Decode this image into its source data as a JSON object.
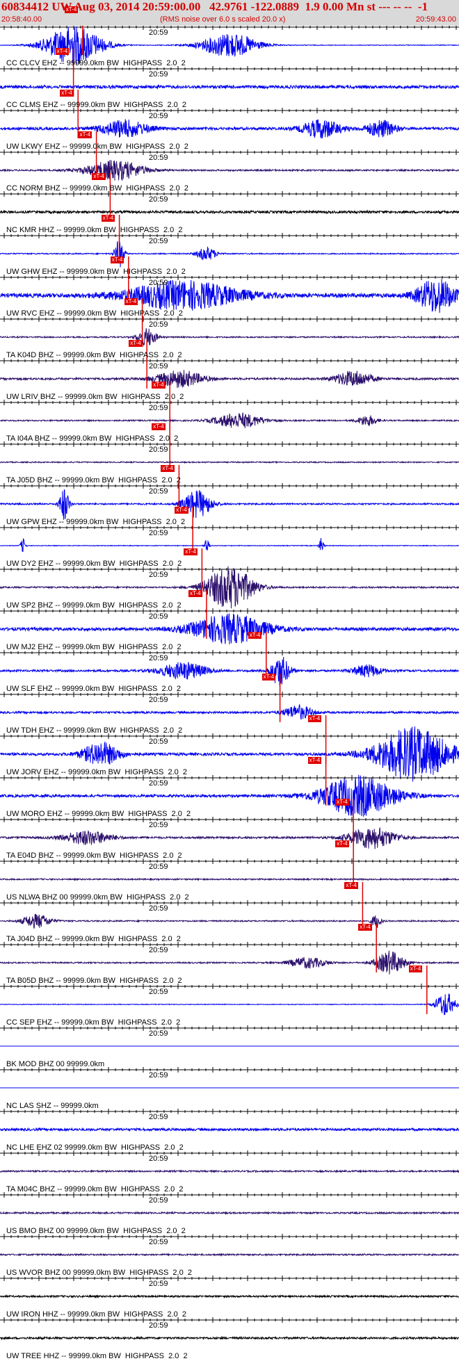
{
  "header": {
    "title": "60834412 UW Aug 03, 2014 20:59:00.00   42.9761 -122.0889  1.9 0.00 Mn st --- -- --  -1",
    "start_time": "20:58:40.00",
    "rms_note": "(RMS noise over 6.0 s scaled 20.0 x)",
    "end_time": "20:59:43.00"
  },
  "colors": {
    "header_bg": "#d9d9d9",
    "header_text": "#d40000",
    "trace_blue": "#0000ee",
    "trace_navy": "#2b0f6b",
    "trace_black": "#000000",
    "pick_red": "#e00000",
    "axis": "#000000"
  },
  "pick_label": "xT-4",
  "minute_label": "20:59",
  "traces": [
    {
      "label": "CC CLCV EHZ -- 99999.0km BW  HIGHPASS  2.0  2",
      "color": "blue",
      "pick": 0.18,
      "bursts": [
        [
          0.16,
          0.06,
          2.6
        ],
        [
          0.5,
          0.06,
          1.6
        ]
      ],
      "noise": 0.15
    },
    {
      "label": "CC CLMS EHZ -- 99999.0km BW  HIGHPASS  2.0  2",
      "color": "blue",
      "pick": 0.16,
      "bursts": [],
      "noise": 0.7
    },
    {
      "label": "UW LKWY EHZ -- 99999.0km BW  HIGHPASS  2.0  2",
      "color": "blue",
      "pick": 0.17,
      "bursts": [
        [
          0.27,
          0.05,
          1.1
        ],
        [
          0.7,
          0.04,
          1.2
        ],
        [
          0.83,
          0.03,
          1.1
        ]
      ],
      "noise": 0.6
    },
    {
      "label": "CC NORM BHZ -- 99999.0km BW  HIGHPASS  2.0  2",
      "color": "navy",
      "pick": 0.21,
      "bursts": [
        [
          0.25,
          0.06,
          1.3
        ]
      ],
      "noise": 0.35
    },
    {
      "label": "NC KMR HHZ -- 99999.0km BW  HIGHPASS  2.0  2",
      "color": "black",
      "pick": 0.24,
      "bursts": [],
      "noise": 0.55
    },
    {
      "label": "UW GHW EHZ -- 99999.0km BW  HIGHPASS  2.0  2",
      "color": "blue",
      "pick": 0.26,
      "bursts": [
        [
          0.26,
          0.01,
          1.8
        ],
        [
          0.45,
          0.02,
          0.9
        ]
      ],
      "noise": 0.25
    },
    {
      "label": "UW RVC EHZ -- 99999.0km BW  HIGHPASS  2.0  2",
      "color": "blue",
      "pick": 0.28,
      "bursts": [
        [
          0.4,
          0.12,
          1.8
        ],
        [
          0.95,
          0.04,
          2.2
        ]
      ],
      "noise": 0.9
    },
    {
      "label": "TA K04D BHZ -- 99999.0km BW  HIGHPASS  2.0  2",
      "color": "navy",
      "pick": 0.31,
      "bursts": [
        [
          0.32,
          0.02,
          1.2
        ]
      ],
      "noise": 0.3
    },
    {
      "label": "UW LRIV BHZ -- 99999.0km BW  HIGHPASS  2.0  2",
      "color": "navy",
      "pick": 0.32,
      "bursts": [
        [
          0.39,
          0.05,
          1.1
        ],
        [
          0.77,
          0.04,
          1.0
        ]
      ],
      "noise": 0.45
    },
    {
      "label": "TA I04A BHZ -- 99999.0km BW  HIGHPASS  2.0  2",
      "color": "navy",
      "pick": 0.37,
      "bursts": [
        [
          0.52,
          0.05,
          1.0
        ],
        [
          0.8,
          0.02,
          0.7
        ]
      ],
      "noise": 0.3
    },
    {
      "label": "TA J05D BHZ -- 99999.0km BW  HIGHPASS  2.0  2",
      "color": "navy",
      "pick": 0.37,
      "bursts": [],
      "noise": 0.25
    },
    {
      "label": "UW GPW EHZ -- 99999.0km BW  HIGHPASS  2.0  2",
      "color": "blue",
      "pick": 0.39,
      "bursts": [
        [
          0.14,
          0.01,
          2.2
        ],
        [
          0.43,
          0.03,
          1.8
        ]
      ],
      "noise": 0.35
    },
    {
      "label": "UW DY2 EHZ -- 99999.0km BW  HIGHPASS  2.0  2",
      "color": "blue",
      "pick": 0.42,
      "bursts": [
        [
          0.05,
          0.005,
          1.0
        ],
        [
          0.45,
          0.005,
          1.0
        ],
        [
          0.7,
          0.005,
          1.0
        ]
      ],
      "noise": 0.15
    },
    {
      "label": "UW SP2 BHZ -- 99999.0km BW  HIGHPASS  2.0  2",
      "color": "navy",
      "pick": 0.44,
      "bursts": [
        [
          0.5,
          0.05,
          2.8
        ]
      ],
      "noise": 0.35
    },
    {
      "label": "UW MJ2 EHZ -- 99999.0km BW  HIGHPASS  2.0  2",
      "color": "blue",
      "pick": 0.45,
      "bursts": [
        [
          0.5,
          0.08,
          1.9
        ]
      ],
      "noise": 0.7
    },
    {
      "label": "UW SLF EHZ -- 99999.0km BW  HIGHPASS  2.0  2",
      "color": "blue",
      "pick": 0.58,
      "bursts": [
        [
          0.4,
          0.05,
          1.1
        ],
        [
          0.61,
          0.02,
          2.0
        ],
        [
          0.8,
          0.03,
          0.8
        ]
      ],
      "noise": 0.45
    },
    {
      "label": "UW TDH EHZ -- 99999.0km BW  HIGHPASS  2.0  2",
      "color": "blue",
      "pick": 0.61,
      "bursts": [
        [
          0.65,
          0.03,
          0.9
        ]
      ],
      "noise": 0.45
    },
    {
      "label": "UW JORV EHZ -- 99999.0km BW  HIGHPASS  2.0  2",
      "color": "blue",
      "pick": 0.71,
      "bursts": [
        [
          0.22,
          0.04,
          1.5
        ],
        [
          0.9,
          0.08,
          3.5
        ]
      ],
      "noise": 0.6
    },
    {
      "label": "UW MORO EHZ -- 99999.0km BW  HIGHPASS  2.0  2",
      "color": "blue",
      "pick": 0.71,
      "bursts": [
        [
          0.78,
          0.08,
          2.6
        ]
      ],
      "noise": 0.6
    },
    {
      "label": "TA E04D BHZ -- 99999.0km BW  HIGHPASS  2.0  2",
      "color": "navy",
      "pick": 0.77,
      "bursts": [
        [
          0.19,
          0.05,
          0.9
        ],
        [
          0.81,
          0.05,
          1.4
        ]
      ],
      "noise": 0.45
    },
    {
      "label": "US NLWA BHZ 00 99999.0km BW  HIGHPASS  2.0  2",
      "color": "navy",
      "pick": 0.77,
      "bursts": [],
      "noise": 0.3
    },
    {
      "label": "TA J04D BHZ -- 99999.0km BW  HIGHPASS  2.0  2",
      "color": "navy",
      "pick": 0.79,
      "bursts": [
        [
          0.08,
          0.03,
          0.9
        ],
        [
          0.82,
          0.01,
          0.9
        ]
      ],
      "noise": 0.3
    },
    {
      "label": "TA B05D BHZ -- 99999.0km BW  HIGHPASS  2.0  2",
      "color": "navy",
      "pick": 0.82,
      "bursts": [
        [
          0.67,
          0.04,
          0.7
        ],
        [
          0.85,
          0.03,
          1.5
        ]
      ],
      "noise": 0.3
    },
    {
      "label": "CC SEP EHZ -- 99999.0km BW  HIGHPASS  2.0  2",
      "color": "blue",
      "pick": 0.93,
      "bursts": [
        [
          0.97,
          0.02,
          1.6
        ]
      ],
      "noise": 0.15
    },
    {
      "label": "BK MOD BHZ 00 99999.0km",
      "color": "blue",
      "pick": null,
      "bursts": [],
      "noise": 0.0
    },
    {
      "label": "NC LAS SHZ -- 99999.0km",
      "color": "blue",
      "pick": null,
      "bursts": [],
      "noise": 0.0
    },
    {
      "label": "NC LHE EHZ 02 99999.0km BW  HIGHPASS  2.0  2",
      "color": "blue",
      "pick": null,
      "bursts": [],
      "noise": 0.55
    },
    {
      "label": "TA M04C BHZ -- 99999.0km BW  HIGHPASS  2.0  2",
      "color": "navy",
      "pick": null,
      "bursts": [],
      "noise": 0.35
    },
    {
      "label": "US BMO BHZ 00 99999.0km BW  HIGHPASS  2.0  2",
      "color": "navy",
      "pick": null,
      "bursts": [],
      "noise": 0.35
    },
    {
      "label": "US WVOR BHZ 00 99999.0km BW  HIGHPASS  2.0  2",
      "color": "navy",
      "pick": null,
      "bursts": [],
      "noise": 0.35
    },
    {
      "label": "UW IRON HHZ -- 99999.0km BW  HIGHPASS  2.0  2",
      "color": "black",
      "pick": null,
      "bursts": [],
      "noise": 0.4
    },
    {
      "label": "UW TREE HHZ -- 99999.0km BW  HIGHPASS  2.0  2",
      "color": "black",
      "pick": null,
      "bursts": [],
      "noise": 0.45
    }
  ]
}
